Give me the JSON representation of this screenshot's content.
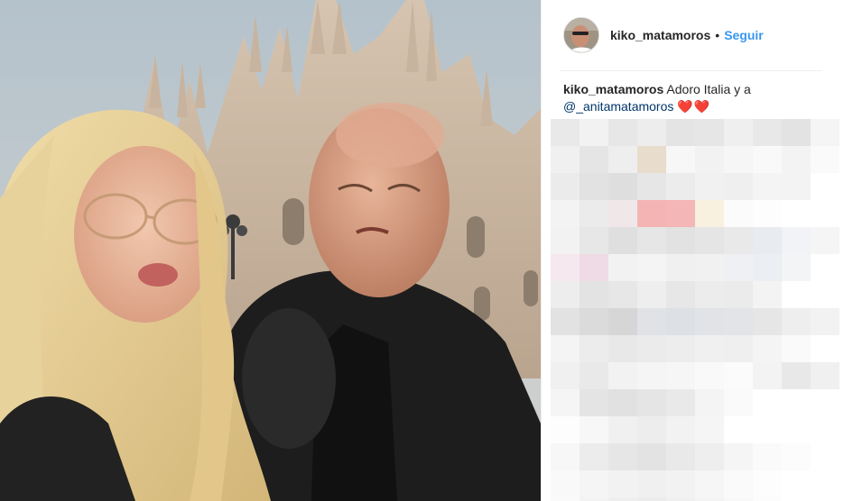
{
  "post": {
    "header": {
      "username": "kiko_matamoros",
      "separator": "•",
      "follow_label": "Seguir",
      "avatar_icon": "profile-photo"
    },
    "caption": {
      "username": "kiko_matamoros",
      "text": "Adoro Italia y a",
      "mention": "@_anitamatamoros",
      "hearts": "❤️❤️"
    },
    "photo": {
      "description_icon": "selfie-photo",
      "colors": {
        "sky": "#c4cdd2",
        "cathedral": "#c9b7a2",
        "hair": "#e6cf94",
        "jacket": "#1c1c1c"
      }
    },
    "comments_pixelated": {
      "icon": "pixelated-comments",
      "colors": [
        "#e9e9e9",
        "#f2f2f2",
        "#e7e7e7",
        "#ededed",
        "#e4e4e4",
        "#e6e6e6",
        "#efefef",
        "#e8e8e8",
        "#e3e3e3",
        "#f5f5f5",
        "#f0f0f0",
        "#e5e5e5",
        "#eeeeee",
        "#e8dccc",
        "#f7f7f7",
        "#f2f2f2",
        "#f6f6f6",
        "#f9f9f9",
        "#f3f3f3",
        "#fafafa",
        "#ebebeb",
        "#e2e2e2",
        "#dedede",
        "#e6e6e6",
        "#ececec",
        "#f1f1f1",
        "#efefef",
        "#f4f4f4",
        "#f3f3f3",
        "#ffffff",
        "#f3f3f3",
        "#ebebeb",
        "#f0e8e8",
        "#f5b4b4",
        "#f4b6b6",
        "#f9f1e0",
        "#fbfbfb",
        "#fdfdfd",
        "#ffffff",
        "#ffffff",
        "#f2f2f2",
        "#e7e7e7",
        "#dfdfdf",
        "#e6e6e6",
        "#e2e2e2",
        "#e5e5e5",
        "#e9e9e9",
        "#e8ebef",
        "#f1f3f6",
        "#f5f5f5",
        "#f5e8ee",
        "#efdbe5",
        "#f2f2f2",
        "#f4f4f4",
        "#f0f0f0",
        "#f1f1f1",
        "#eef0f3",
        "#ebeef2",
        "#f2f4f6",
        "#ffffff",
        "#ededed",
        "#e3e3e3",
        "#e7e7e7",
        "#eeeeee",
        "#e7e7e7",
        "#ececec",
        "#ebebeb",
        "#f3f3f3",
        "#ffffff",
        "#ffffff",
        "#e2e2e2",
        "#dbdbdb",
        "#d6d6d6",
        "#e0e2e6",
        "#dde0e5",
        "#e1e3e7",
        "#e2e4e8",
        "#e6e6e6",
        "#eeeeee",
        "#f2f2f2",
        "#f4f4f4",
        "#ececec",
        "#e8e8e8",
        "#ebebeb",
        "#ededed",
        "#f0f0f0",
        "#efefef",
        "#f4f4f4",
        "#fafafa",
        "#ffffff",
        "#f0f0f0",
        "#e9e9e9",
        "#f2f2f2",
        "#f5f5f5",
        "#f6f6f6",
        "#f9f9f9",
        "#fbfbfb",
        "#f3f3f3",
        "#e8e8e8",
        "#f0f0f0",
        "#f5f5f5",
        "#e4e4e4",
        "#e1e1e1",
        "#e5e5e5",
        "#e9e9e9",
        "#f4f4f4",
        "#fafafa",
        "#ffffff",
        "#ffffff",
        "#ffffff",
        "#fdfdfd",
        "#f7f7f7",
        "#f0f0f0",
        "#ededed",
        "#f2f2f2",
        "#f5f5f5",
        "#ffffff",
        "#ffffff",
        "#ffffff",
        "#ffffff",
        "#f7f7f7",
        "#ececec",
        "#e6e6e6",
        "#e3e3e3",
        "#e9e9e9",
        "#eeeeee",
        "#f5f5f5",
        "#fafafa",
        "#fcfcfc",
        "#ffffff",
        "#f9f9f9",
        "#f5f5f5",
        "#f2f2f2",
        "#f0f0f0",
        "#f2f2f2",
        "#f6f6f6",
        "#fafafa",
        "#fdfdfd",
        "#ffffff",
        "#ffffff",
        "#fafafa",
        "#f3f3f3",
        "#eeeeee",
        "#ececec",
        "#f0f0f0",
        "#f4f4f4",
        "#f8f8f8",
        "#fcfcfc",
        "#ffffff",
        "#ffffff"
      ]
    }
  }
}
